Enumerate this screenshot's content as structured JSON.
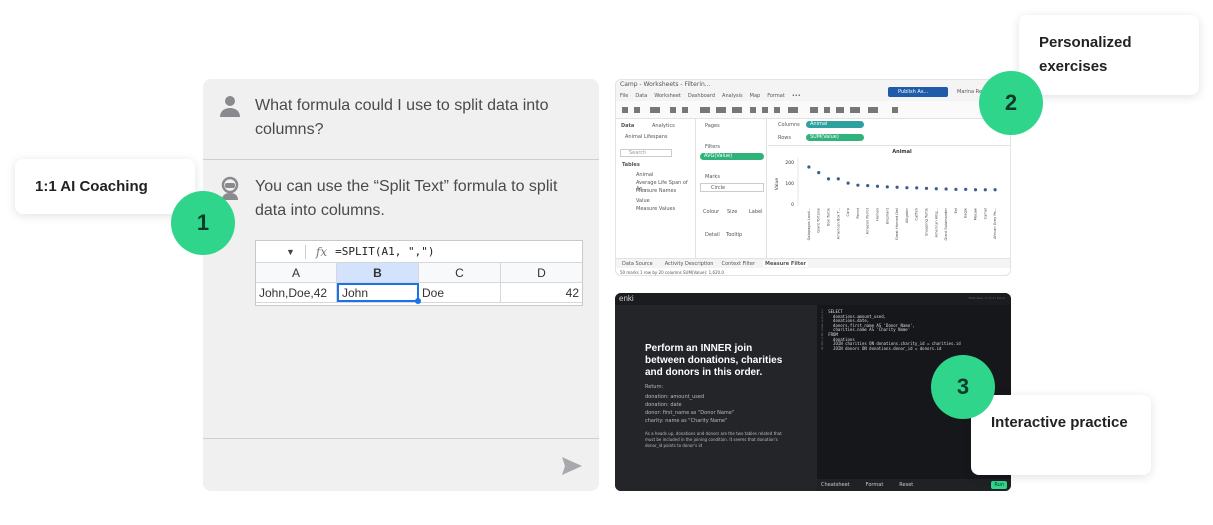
{
  "chat": {
    "question": "What formula could I use to split data into columns?",
    "answer": "You can use the “Split Text” formula to split data into columns.",
    "sheet": {
      "formula": "=SPLIT(A1, \",\")",
      "columns": [
        "A",
        "B",
        "C",
        "D"
      ],
      "cells": [
        "John,Doe,42",
        "John",
        "Doe",
        "42"
      ]
    }
  },
  "labels": {
    "coaching": "1:1 AI Coaching",
    "personalized": "Personalized exercises",
    "interactive": "Interactive practice",
    "badge1": "1",
    "badge2": "2",
    "badge3": "3"
  },
  "tableau": {
    "title": "Camp - Worksheets - Filterin...",
    "menu": [
      "File",
      "Data",
      "Worksheet",
      "Dashboard",
      "Analysis",
      "Map",
      "Format",
      "•••"
    ],
    "publish": "Publish As...",
    "user": "Marina Re...",
    "side_tabs": [
      "Data",
      "Analytics"
    ],
    "source": "Animal Lifespans",
    "search": "Search",
    "tables_heading": "Tables",
    "fields": [
      "Animal",
      "Average Life Span of An...",
      "Measure Names",
      "Value",
      "Measure Values"
    ],
    "pages": "Pages",
    "filters": "Filters",
    "filter_pill": "AVG(Value)",
    "marks": "Marks",
    "mark_type": "Circle",
    "mark_buttons": [
      "Colour",
      "Size",
      "Label",
      "Detail",
      "Tooltip"
    ],
    "columns_label": "Columns",
    "rows_label": "Rows",
    "columns_pill": "Animal",
    "rows_pill": "SUM(Value)",
    "bottom_tabs": [
      "Data Source",
      "Activity Description",
      "Context Filter",
      "Measure Filter"
    ],
    "status": "50 marks   1 row by 20 columns   SUM(Value): 1,620.0"
  },
  "chart_data": {
    "type": "scatter",
    "title": "Animal",
    "ylabel": "Value",
    "ylim": [
      0,
      220
    ],
    "yticks": [
      0,
      100,
      200
    ],
    "categories": [
      "Galapagos Land...",
      "Giant Tortoise",
      "Box Turtle",
      "American Box T...",
      "Carp",
      "Parrot",
      "Amazon Parrot",
      "Human",
      "Elephant",
      "Great Horned Owl",
      "Alligator",
      "Catfish",
      "Snapping Turtle",
      "American Allig...",
      "Giant Salamander",
      "Eel",
      "Eagle",
      "Macaw",
      "Camel",
      "African Grey Pa..."
    ],
    "values": [
      177,
      150,
      120,
      120,
      100,
      90,
      88,
      85,
      82,
      80,
      78,
      77,
      75,
      73,
      72,
      70,
      70,
      68,
      68,
      68
    ]
  },
  "coding": {
    "logo": "enki",
    "heading": "Perform an INNER join between donations, charities and donors in this order.",
    "return_label": "Return:",
    "bullets": [
      "donation: amount_used",
      "donation: date",
      "donor: first_name as \"Donor Name\"",
      "charity: name as \"Charity Name\""
    ],
    "hint": "As a heads up, donations and donors are the two tables related that must be included in the joining condition. It seems that donation's donor_id points to donor's id",
    "code_lines": [
      "SELECT",
      "  donations.amount_used,",
      "  donations.date,",
      "  donors.first_name AS 'Donor Name',",
      "  charities.name AS 'Charity Name'",
      "FROM",
      "  donations",
      "  JOIN charities ON donations.charity_id = charities.id",
      "  JOIN donors ON donations.donor_id = donors.id"
    ],
    "footer": [
      "Cheatsheet",
      "Format",
      "Reset",
      "Run"
    ],
    "top_right": "Exercises / 1 of 3 / Done"
  },
  "colors": {
    "accent": "#2fd58a",
    "pill": "#2fd58a"
  }
}
